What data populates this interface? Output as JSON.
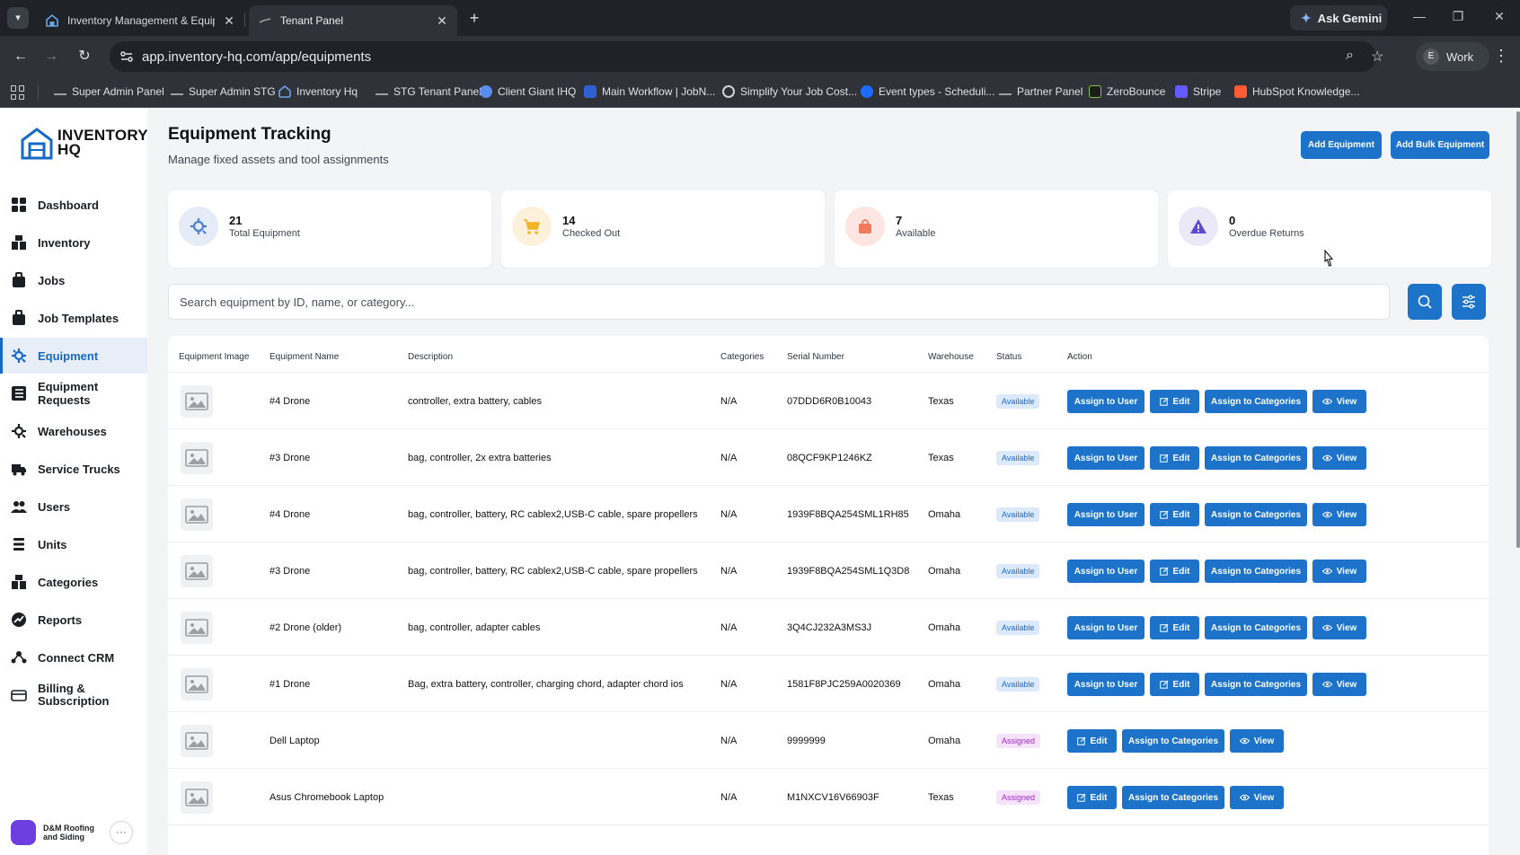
{
  "browser": {
    "tabs": [
      {
        "title": "Inventory Management & Equipment"
      },
      {
        "title": "Tenant Panel"
      }
    ],
    "new_tab_label": "+",
    "gemini_label": "Ask Gemini",
    "url": "app.inventory-hq.com/app/equipments",
    "profile_initial": "E",
    "profile_label": "Work",
    "bookmarks": [
      {
        "label": "Super Admin Panel"
      },
      {
        "label": "Super Admin STG"
      },
      {
        "label": "Inventory Hq"
      },
      {
        "label": "STG Tenant Panel"
      },
      {
        "label": "Client Giant IHQ"
      },
      {
        "label": "Main Workflow | JobN..."
      },
      {
        "label": "Simplify Your Job Cost..."
      },
      {
        "label": "Event types - Scheduli..."
      },
      {
        "label": "Partner Panel"
      },
      {
        "label": "ZeroBounce"
      },
      {
        "label": "Stripe"
      },
      {
        "label": "HubSpot Knowledge..."
      }
    ]
  },
  "brand": {
    "line1": "INVENTORY",
    "line2": "HQ"
  },
  "sidebar": {
    "items": [
      {
        "label": "Dashboard",
        "icon": "dashboard-icon"
      },
      {
        "label": "Inventory",
        "icon": "inventory-icon"
      },
      {
        "label": "Jobs",
        "icon": "jobs-icon"
      },
      {
        "label": "Job Templates",
        "icon": "job-templates-icon"
      },
      {
        "label": "Equipment",
        "icon": "equipment-icon",
        "active": true
      },
      {
        "label": "Equipment Requests",
        "icon": "equipment-requests-icon"
      },
      {
        "label": "Warehouses",
        "icon": "warehouses-icon"
      },
      {
        "label": "Service Trucks",
        "icon": "truck-icon"
      },
      {
        "label": "Users",
        "icon": "users-icon"
      },
      {
        "label": "Units",
        "icon": "units-icon"
      },
      {
        "label": "Categories",
        "icon": "categories-icon"
      },
      {
        "label": "Reports",
        "icon": "reports-icon"
      },
      {
        "label": "Connect CRM",
        "icon": "crm-icon"
      },
      {
        "label": "Billing & Subscription",
        "icon": "billing-icon"
      }
    ],
    "account": {
      "name": "D&M Roofing and Siding",
      "more": "···"
    }
  },
  "header": {
    "title": "Equipment Tracking",
    "subtitle": "Manage fixed assets and tool assignments",
    "add_label": "Add Equipment",
    "bulk_label": "Add Bulk Equipment"
  },
  "stats": [
    {
      "value": "21",
      "label": "Total Equipment",
      "icon": "gear-icon",
      "color": "#e5ecf8"
    },
    {
      "value": "14",
      "label": "Checked Out",
      "icon": "cart-icon",
      "color": "#fdf1dc"
    },
    {
      "value": "7",
      "label": "Available",
      "icon": "bag-icon",
      "color": "#fde6e1"
    },
    {
      "value": "0",
      "label": "Overdue Returns",
      "icon": "warning-icon",
      "color": "#ebe8f8"
    }
  ],
  "search": {
    "placeholder": "Search equipment by ID, name, or category..."
  },
  "table": {
    "columns": [
      "Equipment Image",
      "Equipment Name",
      "Description",
      "Categories",
      "Serial Number",
      "Warehouse",
      "Status",
      "Action"
    ],
    "buttons": {
      "assign_user": "Assign to User",
      "edit": "Edit",
      "assign_categories": "Assign to Categories",
      "view": "View"
    },
    "rows": [
      {
        "name": "#4 Drone",
        "description": "controller, extra battery, cables",
        "categories": "N/A",
        "serial": "07DDD6R0B10043",
        "warehouse": "Texas",
        "status": "Available"
      },
      {
        "name": "#3 Drone",
        "description": "bag, controller, 2x extra batteries",
        "categories": "N/A",
        "serial": "08QCF9KP1246KZ",
        "warehouse": "Texas",
        "status": "Available"
      },
      {
        "name": "#4 Drone",
        "description": "bag, controller, battery, RC cablex2,USB-C cable, spare propellers",
        "categories": "N/A",
        "serial": "1939F8BQA254SML1RH85",
        "warehouse": "Omaha",
        "status": "Available"
      },
      {
        "name": "#3 Drone",
        "description": "bag, controller, battery, RC cablex2,USB-C cable, spare propellers",
        "categories": "N/A",
        "serial": "1939F8BQA254SML1Q3D8",
        "warehouse": "Omaha",
        "status": "Available"
      },
      {
        "name": "#2 Drone (older)",
        "description": "bag, controller, adapter cables",
        "categories": "N/A",
        "serial": "3Q4CJ232A3MS3J",
        "warehouse": "Omaha",
        "status": "Available"
      },
      {
        "name": "#1 Drone",
        "description": "Bag, extra battery, controller, charging chord, adapter chord ios",
        "categories": "N/A",
        "serial": "1581F8PJC259A0020369",
        "warehouse": "Omaha",
        "status": "Available"
      },
      {
        "name": "Dell Laptop",
        "description": "",
        "categories": "N/A",
        "serial": "9999999",
        "warehouse": "Omaha",
        "status": "Assigned"
      },
      {
        "name": "Asus Chromebook Laptop",
        "description": "",
        "categories": "N/A",
        "serial": "M1NXCV16V66903F",
        "warehouse": "Texas",
        "status": "Assigned"
      }
    ]
  },
  "colors": {
    "accent": "#1d73c9",
    "available_bg": "#dbe9fb",
    "assigned_bg": "#f5e3fb"
  }
}
